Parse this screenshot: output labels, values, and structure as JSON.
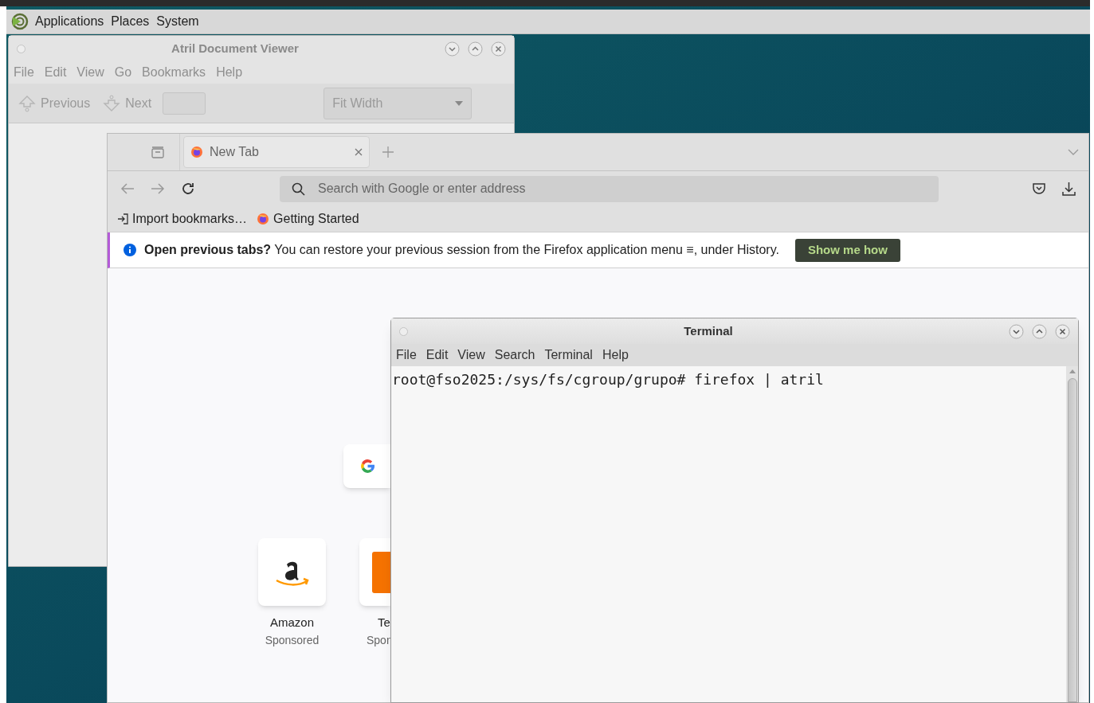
{
  "panel": {
    "menus": [
      "Applications",
      "Places",
      "System"
    ]
  },
  "atril": {
    "title": "Atril Document Viewer",
    "menus": [
      "File",
      "Edit",
      "View",
      "Go",
      "Bookmarks",
      "Help"
    ],
    "previous": "Previous",
    "next": "Next",
    "zoom": "Fit Width"
  },
  "firefox": {
    "tabs": [
      {
        "label": "New Tab",
        "selected": true
      }
    ],
    "address_placeholder": "Search with Google or enter address",
    "bookmarks": [
      {
        "label": "Import bookmarks…",
        "kind": "import"
      },
      {
        "label": "Getting Started",
        "kind": "firefox"
      }
    ],
    "notification": {
      "text": "**Open previous tabs?** You can restore your previous session from the Firefox application menu ≡, under History.",
      "button": "Show me how"
    },
    "shortcuts": [
      {
        "title": "Amazon",
        "subtitle": "Sponsored",
        "kind": "amazon"
      },
      {
        "title": "Te",
        "subtitle": "Spon",
        "kind": "tile-logo"
      }
    ]
  },
  "terminal": {
    "title": "Terminal",
    "menus": [
      "File",
      "Edit",
      "View",
      "Search",
      "Terminal",
      "Help"
    ],
    "lines": [
      "root@fso2025:/sys/fs/cgroup/grupo# firefox | atril"
    ]
  }
}
